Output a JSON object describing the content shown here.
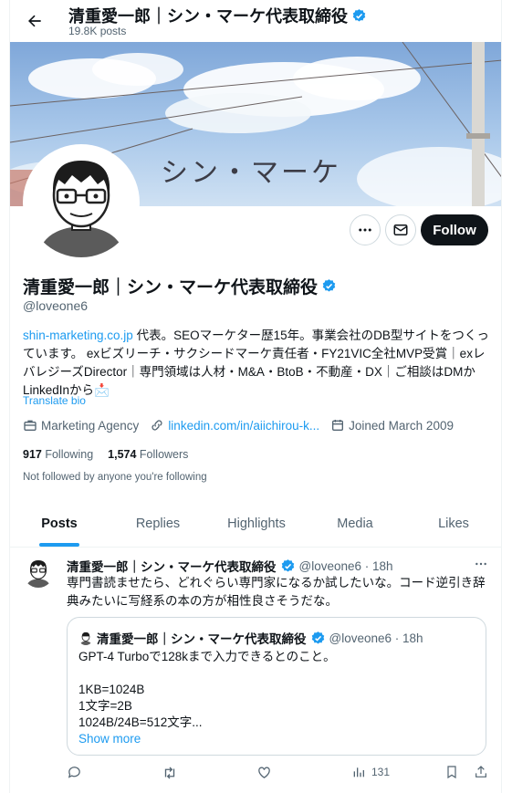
{
  "header": {
    "title": "清重愛一郎｜シン・マーケ代表取締役",
    "posts_count": "19.8K posts"
  },
  "banner": {
    "text": "シン・マーケ"
  },
  "profile": {
    "name": "清重愛一郎｜シン・マーケ代表取締役",
    "handle": "@loveone6",
    "follow_label": "Follow",
    "bio": {
      "link": "shin-marketing.co.jp",
      "text": " 代表。SEOマーケター歴15年。事業会社のDB型サイトをつくっています。 exビズリーチ・サクシードマーケ責任者・FY21VIC全社MVP受賞｜exレバレジーズDirector｜専門領域は人材・M&A・BtoB・不動産・DX｜ご相談はDMかLinkedInから📩"
    },
    "translate_label": "Translate bio",
    "category": "Marketing Agency",
    "website": "linkedin.com/in/aiichirou-k...",
    "joined": "Joined March 2009",
    "following_count": "917",
    "following_label": "Following",
    "followers_count": "1,574",
    "followers_label": "Followers",
    "not_followed": "Not followed by anyone you're following"
  },
  "tabs": [
    {
      "label": "Posts",
      "active": true
    },
    {
      "label": "Replies",
      "active": false
    },
    {
      "label": "Highlights",
      "active": false
    },
    {
      "label": "Media",
      "active": false
    },
    {
      "label": "Likes",
      "active": false
    }
  ],
  "tweet": {
    "name": "清重愛一郎｜シン・マーケ代表取締役",
    "meta": "@loveone6 · 18h",
    "text": "専門書読ませたら、どれぐらい専門家になるか試したいな。コード逆引き辞典みたいに写経系の本の方が相性良さそうだな。",
    "quote": {
      "name": "清重愛一郎｜シン・マーケ代表取締役",
      "meta": "@loveone6 · 18h",
      "lines": [
        "GPT-4 Turboで128kまで入力できるとのこと。",
        "",
        "1KB=1024B",
        "1文字=2B",
        "1024B/24B=512文字..."
      ],
      "show_more": "Show more"
    },
    "views": "131"
  },
  "colors": {
    "accent": "#1d9bf0",
    "text": "#0f1419",
    "muted": "#536471"
  }
}
